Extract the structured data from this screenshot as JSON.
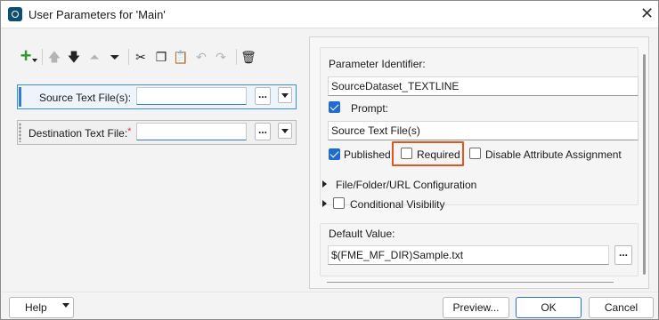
{
  "window": {
    "title": "User Parameters for 'Main'"
  },
  "toolbar": {
    "icons": [
      "add-icon",
      "move-up-icon",
      "move-down-icon",
      "move-top-icon",
      "move-bottom-icon",
      "cut-icon",
      "copy-icon",
      "paste-icon",
      "undo-icon",
      "redo-icon",
      "delete-icon"
    ]
  },
  "parameters": [
    {
      "label": "Source Text File(s):",
      "value": "",
      "required": false,
      "selected": true
    },
    {
      "label": "Destination Text File:",
      "value": "",
      "required": true,
      "selected": false
    }
  ],
  "ellipsis_label": "...",
  "panel": {
    "identifier_label": "Parameter Identifier:",
    "identifier_value": "SourceDataset_TEXTLINE",
    "prompt_label": "Prompt:",
    "prompt_checked": true,
    "prompt_value": "Source Text File(s)",
    "published_label": "Published",
    "published_checked": true,
    "required_label": "Required",
    "required_checked": false,
    "disable_label": "Disable Attribute Assignment",
    "disable_checked": false,
    "file_config_label": "File/Folder/URL Configuration",
    "conditional_label": "Conditional Visibility",
    "conditional_checked": false,
    "default_label": "Default Value:",
    "default_value": "$(FME_MF_DIR)Sample.txt"
  },
  "buttons": {
    "help": "Help",
    "preview": "Preview...",
    "ok": "OK",
    "cancel": "Cancel"
  },
  "colors": {
    "highlight": "#e1571e",
    "accent": "#1f6bd1"
  }
}
